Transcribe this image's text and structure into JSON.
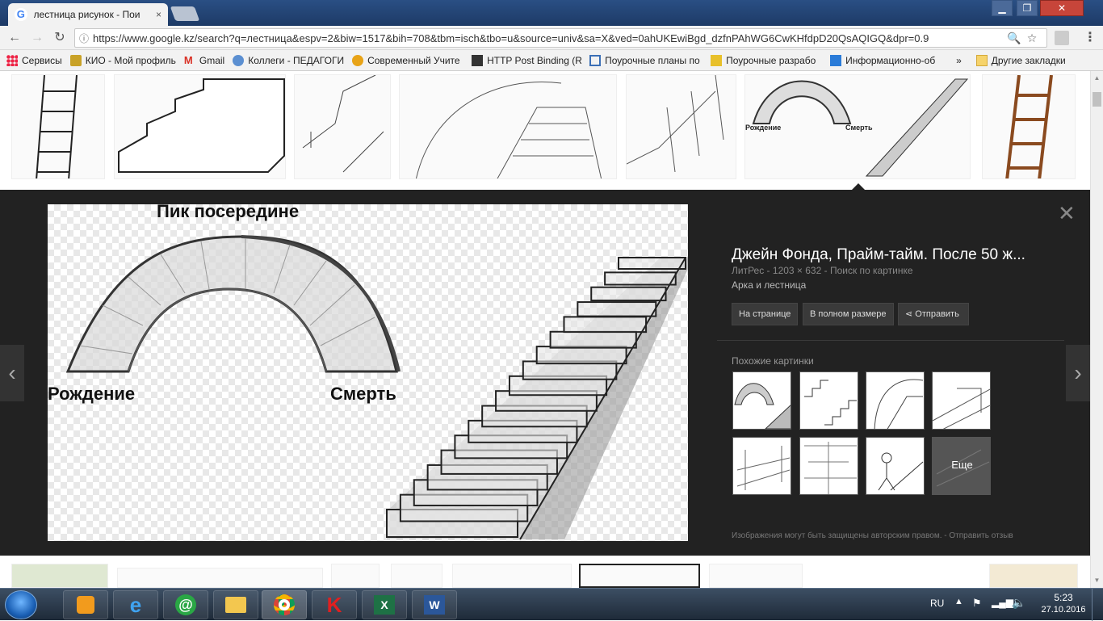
{
  "browser": {
    "tab_title": "лестница рисунок - Пои",
    "tab_close": "×",
    "url": "https://www.google.kz/search?q=лестница&espv=2&biw=1517&bih=708&tbm=isch&tbo=u&source=univ&sa=X&ved=0ahUKEwiBgd_dzfnPAhWG6CwKHfdpD20QsAQIGQ&dpr=0.9",
    "window_buttons": [
      "▁",
      "❐",
      "✕"
    ]
  },
  "bookmarks": {
    "items": [
      {
        "label": "Сервисы",
        "icon": "apps-grid-icon",
        "color": "#4285f4"
      },
      {
        "label": "КИО - Мой профиль",
        "icon": "bookmark-icon",
        "color": "#c9a227"
      },
      {
        "label": "Gmail",
        "icon": "gmail-icon",
        "color": "#d93025"
      },
      {
        "label": "Коллеги - ПЕДАГОГИ",
        "icon": "site-icon",
        "color": "#5b8fd1"
      },
      {
        "label": "Современный Учите",
        "icon": "site-icon",
        "color": "#e8a317"
      },
      {
        "label": "HTTP Post Binding (Re",
        "icon": "doc-icon",
        "color": "#333333"
      },
      {
        "label": "Поурочные планы по",
        "icon": "site-icon",
        "color": "#3b6fb6"
      },
      {
        "label": "Поурочные разрабо",
        "icon": "site-icon",
        "color": "#e8c02a"
      },
      {
        "label": "Информационно-об",
        "icon": "site-icon",
        "color": "#2a7bd8"
      }
    ],
    "more": "»",
    "other": "Другие закладки"
  },
  "preview": {
    "label_top": "Пик посередине",
    "label_left": "Рождение",
    "label_right": "Смерть"
  },
  "panel": {
    "title": "Джейн Фонда, Прайм-тайм. После 50 ж...",
    "meta": "ЛитРес - 1203 × 632 - Поиск по картинке",
    "caption": "Арка и лестница",
    "btn_page": "На странице",
    "btn_full": "В полном размере",
    "btn_share": "Отправить",
    "similar_title": "Похожие картинки",
    "more": "Еще",
    "footer": "Изображения могут быть защищены авторским правом. - Отправить отзыв"
  },
  "tray": {
    "lang": "RU",
    "time": "5:23",
    "date": "27.10.2016"
  }
}
